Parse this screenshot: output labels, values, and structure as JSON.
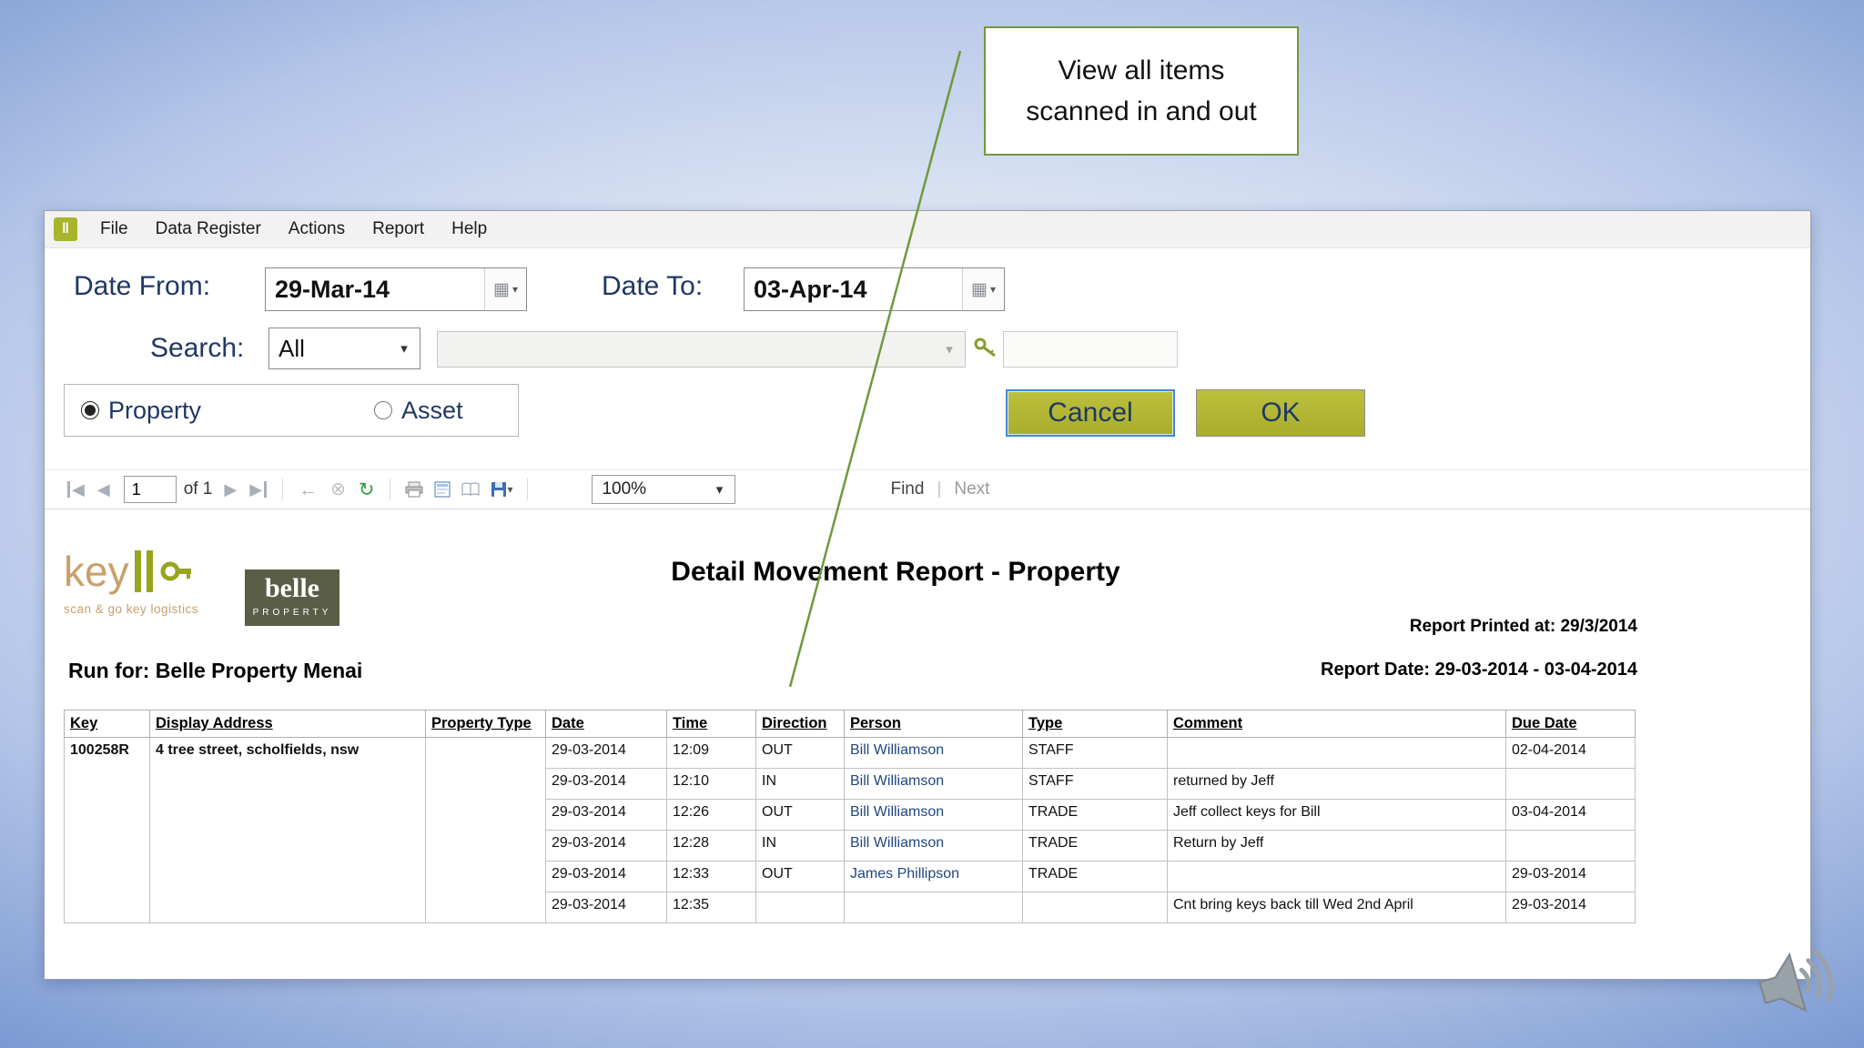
{
  "callout": {
    "line1": "View all items",
    "line2": "scanned in and out"
  },
  "menu": {
    "items": [
      "File",
      "Data Register",
      "Actions",
      "Report",
      "Help"
    ]
  },
  "filters": {
    "date_from_label": "Date From:",
    "date_from_value": "29-Mar-14",
    "date_to_label": "Date To:",
    "date_to_value": "03-Apr-14",
    "search_label": "Search:",
    "search_value": "All",
    "secondary_search_value": "",
    "keyword_value": "",
    "property_label": "Property",
    "asset_label": "Asset",
    "property_selected": true,
    "cancel_label": "Cancel",
    "ok_label": "OK"
  },
  "viewer": {
    "page_number": "1",
    "of_label": "of 1",
    "zoom_value": "100%",
    "find_label": "Find",
    "find_separator": "|",
    "next_label": "Next"
  },
  "report": {
    "logo_key": "key",
    "logo_tagline": "scan & go key logistics",
    "belle_name": "belle",
    "belle_sub": "PROPERTY",
    "title": "Detail Movement Report - Property",
    "printed_at": "Report Printed at: 29/3/2014",
    "run_for": "Run for: Belle Property Menai",
    "report_date": "Report Date: 29-03-2014 - 03-04-2014",
    "table": {
      "merged_leading_columns": 3,
      "columns": [
        "Key",
        "Display Address",
        "Property Type",
        "Date",
        "Time",
        "Direction",
        "Person",
        "Type",
        "Comment",
        "Due Date"
      ],
      "rows": [
        [
          "100258R",
          "4 tree street, scholfields, nsw",
          "",
          "29-03-2014",
          "12:09",
          "OUT",
          "Bill Williamson",
          "STAFF",
          "",
          "02-04-2014"
        ],
        [
          "",
          "",
          "",
          "29-03-2014",
          "12:10",
          "IN",
          "Bill Williamson",
          "STAFF",
          "returned by Jeff",
          ""
        ],
        [
          "",
          "",
          "",
          "29-03-2014",
          "12:26",
          "OUT",
          "Bill Williamson",
          "TRADE",
          "Jeff collect keys for Bill",
          "03-04-2014"
        ],
        [
          "",
          "",
          "",
          "29-03-2014",
          "12:28",
          "IN",
          "Bill Williamson",
          "TRADE",
          "Return by Jeff",
          ""
        ],
        [
          "",
          "",
          "",
          "29-03-2014",
          "12:33",
          "OUT",
          "James Phillipson",
          "TRADE",
          "",
          "29-03-2014"
        ],
        [
          "",
          "",
          "",
          "29-03-2014",
          "12:35",
          "",
          "",
          "",
          "Cnt bring keys back till Wed 2nd April",
          "29-03-2014"
        ]
      ]
    }
  },
  "icons": {
    "app_logo": "‖",
    "calendar": "▦",
    "dropdown": "▾",
    "prev": "◀",
    "next": "▶",
    "back": "←",
    "stop": "⊗",
    "refresh": "↻"
  },
  "colors": {
    "accent_olive": "#afb42f",
    "label_navy": "#1f3864",
    "callout_green": "#75973b",
    "refresh_green": "#2e9e44",
    "logo_tan": "#c9a06b",
    "logo_olive": "#97a51f",
    "belle_bg": "#5a5e46"
  }
}
